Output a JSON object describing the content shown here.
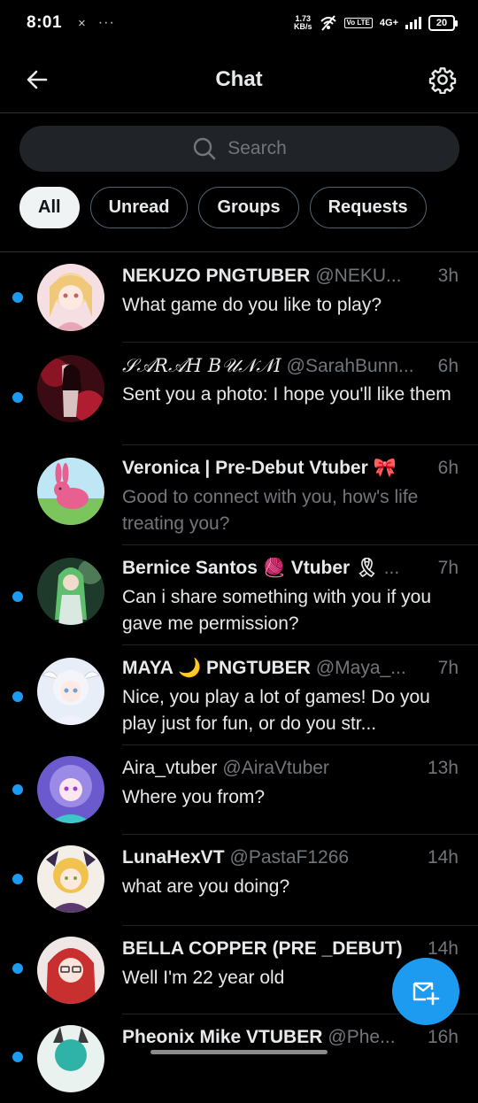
{
  "status_bar": {
    "time": "8:01",
    "close_glyph": "×",
    "more_glyph": "···",
    "speed_value": "1.73",
    "speed_unit": "KB/s",
    "volte": "Vo LTE",
    "network": "4G+",
    "battery": "20"
  },
  "header": {
    "title": "Chat",
    "back_icon": "arrow-left-icon",
    "settings_icon": "gear-icon"
  },
  "search": {
    "placeholder": "Search",
    "icon": "search-icon"
  },
  "filters": [
    "All",
    "Unread",
    "Groups",
    "Requests"
  ],
  "active_filter": "All",
  "conversations": [
    {
      "name": "NEKUZO PNGTUBER",
      "handle": "@NEKU...",
      "time": "3h",
      "message": "What game do you like to play?",
      "unread": true
    },
    {
      "name": "𝒮𝒜𝑅𝒜𝐻 𝐵𝒰𝒩𝒩𝐼",
      "handle": "@SarahBunn...",
      "time": "6h",
      "message": "Sent you a photo: I hope you'll like them",
      "unread": true
    },
    {
      "name": "Veronica | Pre-Debut Vtuber 🎀",
      "handle": "",
      "time": "6h",
      "message": "Good to connect with you, how's life treating you?",
      "unread": false
    },
    {
      "name": "Bernice Santos 🧶 Vtuber 🎗",
      "handle": "...",
      "time": "7h",
      "message": "Can i share something with you if you gave me permission?",
      "unread": true
    },
    {
      "name": "MAYA 🌙 PNGTUBER",
      "handle": "@Maya_...",
      "time": "7h",
      "message": "Nice, you play a lot of games! Do you play just for fun, or do you str...",
      "unread": true
    },
    {
      "name": "Aira_vtuber",
      "handle": "@AiraVtuber",
      "time": "13h",
      "message": "Where you from?",
      "unread": true
    },
    {
      "name": "LunaHexVT",
      "handle": "@PastaF1266",
      "time": "14h",
      "message": "what are you doing?",
      "unread": true
    },
    {
      "name": "BELLA COPPER (PRE _DEBUT)",
      "handle": "",
      "time": "14h",
      "message": "Well I'm 22 year old",
      "unread": true
    },
    {
      "name": "Pheonix Mike VTUBER",
      "handle": "@Phe...",
      "time": "16h",
      "message": "",
      "unread": true
    }
  ],
  "fab": {
    "icon": "new-message-icon"
  },
  "colors": {
    "accent": "#1d9bf0",
    "background": "#000000",
    "muted": "#71767b"
  }
}
